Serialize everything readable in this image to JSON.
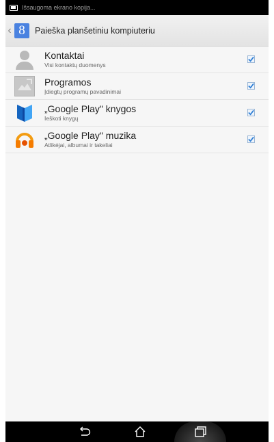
{
  "status_bar": {
    "notification_text": "Išsaugoma ekrano kopija..."
  },
  "action_bar": {
    "title": "Paieška planšetiniu kompiuteriu",
    "logo_letter": "8"
  },
  "items": [
    {
      "title": "Kontaktai",
      "subtitle": "Visi kontaktų duomenys",
      "checked": true,
      "icon": "contacts-icon"
    },
    {
      "title": "Programos",
      "subtitle": "Įdiegtų programų pavadinimai",
      "checked": true,
      "icon": "apps-icon"
    },
    {
      "title": "„Google Play\" knygos",
      "subtitle": "Ieškoti knygų",
      "checked": true,
      "icon": "google-play-books-icon"
    },
    {
      "title": "„Google Play\" muzika",
      "subtitle": "Atlikėjai, albumai ir takeliai",
      "checked": true,
      "icon": "google-play-music-icon"
    }
  ],
  "colors": {
    "checkmark": "#2f7fd6",
    "google_blue": "#4a82e0",
    "books_blue": "#1e88e5",
    "music_orange": "#f39c12"
  },
  "nav_bar": {
    "buttons": [
      "back-icon",
      "home-icon",
      "recent-apps-icon"
    ]
  }
}
